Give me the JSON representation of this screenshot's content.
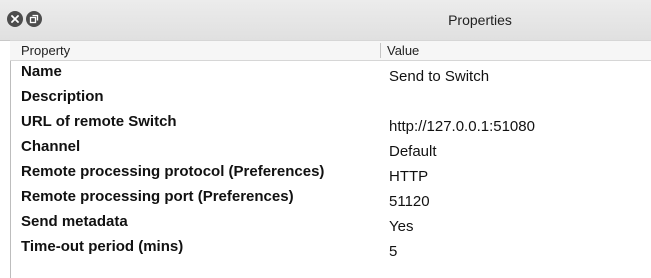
{
  "window": {
    "title": "Properties",
    "close_icon": "close-icon",
    "float_icon": "float-icon"
  },
  "table": {
    "headers": {
      "property": "Property",
      "value": "Value"
    },
    "rows": [
      {
        "property": "Name",
        "value": "Send to Switch"
      },
      {
        "property": "Description",
        "value": ""
      },
      {
        "property": "URL of remote Switch",
        "value": "http://127.0.0.1:51080"
      },
      {
        "property": "Channel",
        "value": "Default"
      },
      {
        "property": "Remote processing protocol (Preferences)",
        "value": "HTTP"
      },
      {
        "property": "Remote processing port (Preferences)",
        "value": "51120"
      },
      {
        "property": "Send metadata",
        "value": "Yes"
      },
      {
        "property": "Time-out period (mins)",
        "value": "5"
      }
    ]
  }
}
